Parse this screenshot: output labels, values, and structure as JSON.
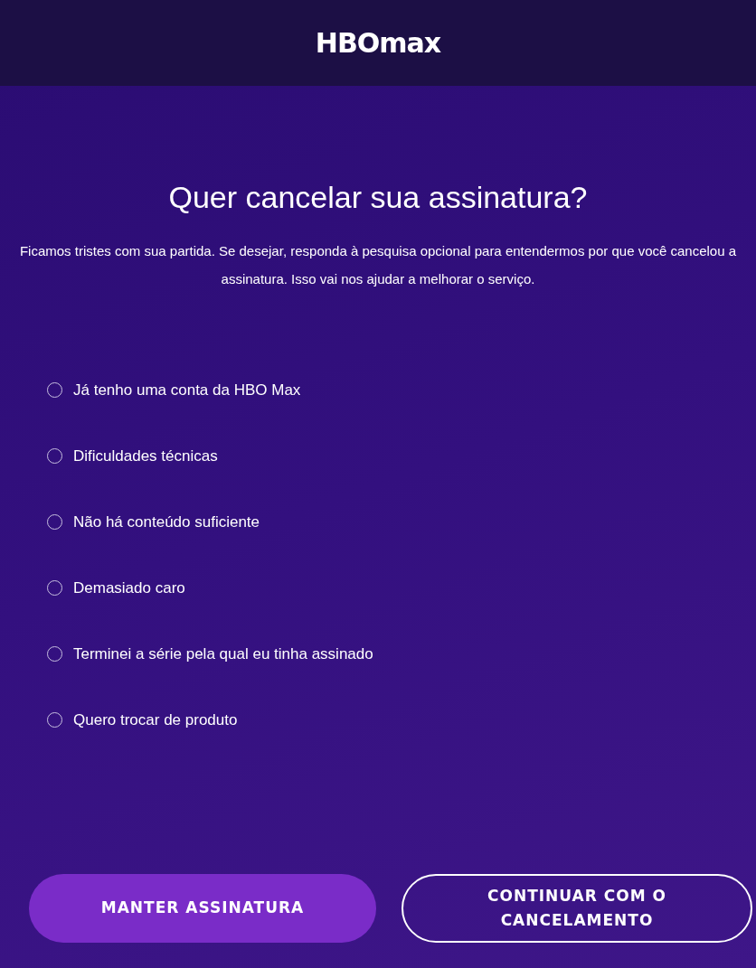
{
  "header": {
    "logo": "HBOmax"
  },
  "title": "Quer cancelar sua assinatura?",
  "description": "Ficamos tristes com sua partida. Se desejar, responda à pesquisa opcional para entendermos por que você cancelou a assinatura. Isso vai nos ajudar a melhorar o serviço.",
  "options": [
    {
      "label": "Já tenho uma conta da HBO Max",
      "selected": false
    },
    {
      "label": "Dificuldades técnicas",
      "selected": false
    },
    {
      "label": "Não há conteúdo suficiente",
      "selected": false
    },
    {
      "label": "Demasiado caro",
      "selected": false
    },
    {
      "label": "Terminei a série pela qual eu tinha assinado",
      "selected": false
    },
    {
      "label": "Quero trocar de produto",
      "selected": false
    }
  ],
  "buttons": [
    {
      "label": "MANTER ASSINATURA",
      "kind": "primary"
    },
    {
      "label": "CONTINUAR COM O CANCELAMENTO",
      "kind": "outline"
    }
  ]
}
